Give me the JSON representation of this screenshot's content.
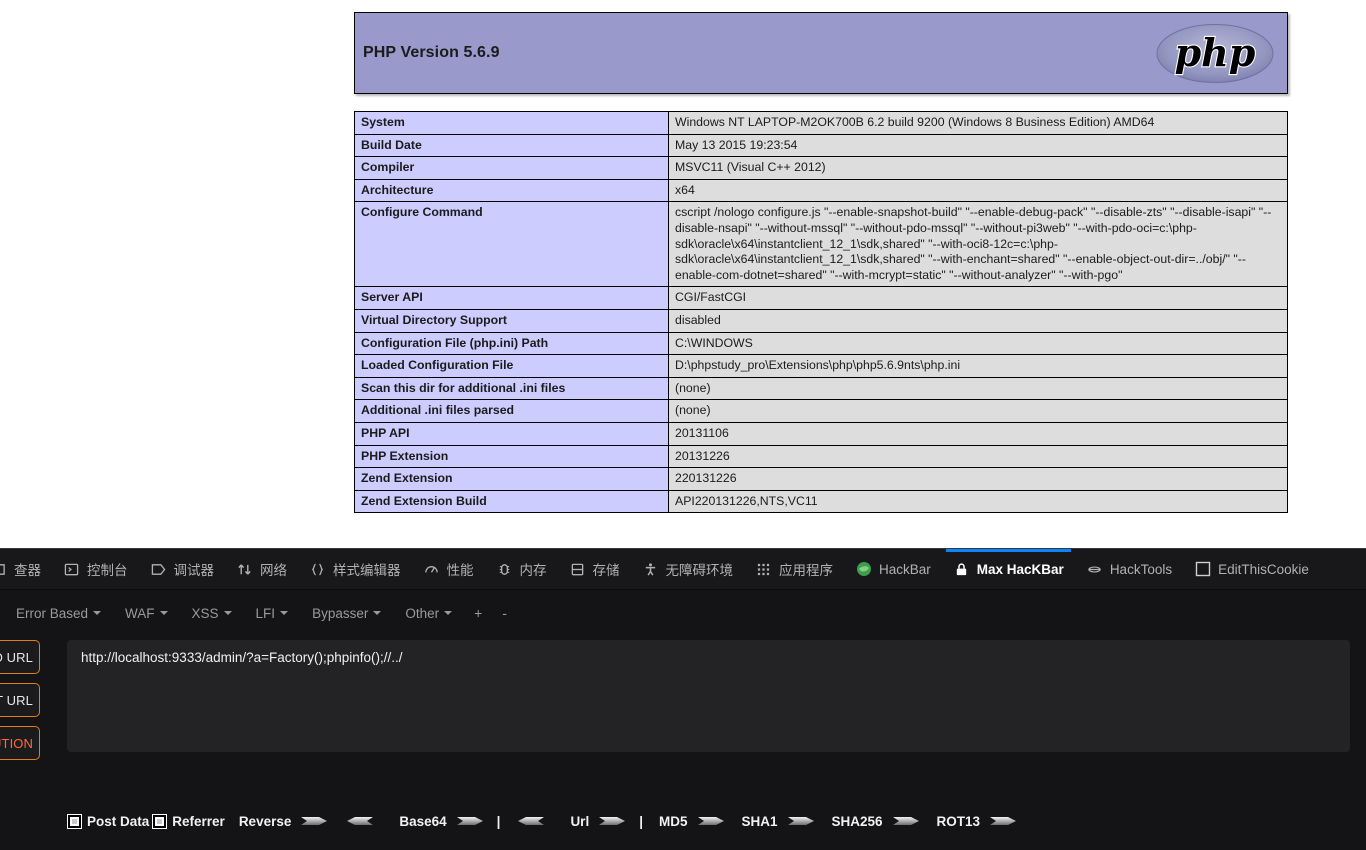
{
  "page": {
    "header_title": "PHP Version 5.6.9",
    "logo_text": "php",
    "rows": [
      {
        "key": "System",
        "value": "Windows NT LAPTOP-M2OK700B 6.2 build 9200 (Windows 8 Business Edition) AMD64"
      },
      {
        "key": "Build Date",
        "value": "May 13 2015 19:23:54"
      },
      {
        "key": "Compiler",
        "value": "MSVC11 (Visual C++ 2012)"
      },
      {
        "key": "Architecture",
        "value": "x64"
      },
      {
        "key": "Configure Command",
        "value": "cscript /nologo configure.js \"--enable-snapshot-build\" \"--enable-debug-pack\" \"--disable-zts\" \"--disable-isapi\" \"--disable-nsapi\" \"--without-mssql\" \"--without-pdo-mssql\" \"--without-pi3web\" \"--with-pdo-oci=c:\\php-sdk\\oracle\\x64\\instantclient_12_1\\sdk,shared\" \"--with-oci8-12c=c:\\php-sdk\\oracle\\x64\\instantclient_12_1\\sdk,shared\" \"--with-enchant=shared\" \"--enable-object-out-dir=../obj/\" \"--enable-com-dotnet=shared\" \"--with-mcrypt=static\" \"--without-analyzer\" \"--with-pgo\""
      },
      {
        "key": "Server API",
        "value": "CGI/FastCGI"
      },
      {
        "key": "Virtual Directory Support",
        "value": "disabled"
      },
      {
        "key": "Configuration File (php.ini) Path",
        "value": "C:\\WINDOWS"
      },
      {
        "key": "Loaded Configuration File",
        "value": "D:\\phpstudy_pro\\Extensions\\php\\php5.6.9nts\\php.ini"
      },
      {
        "key": "Scan this dir for additional .ini files",
        "value": "(none)"
      },
      {
        "key": "Additional .ini files parsed",
        "value": "(none)"
      },
      {
        "key": "PHP API",
        "value": "20131106"
      },
      {
        "key": "PHP Extension",
        "value": "20131226"
      },
      {
        "key": "Zend Extension",
        "value": "220131226"
      },
      {
        "key": "Zend Extension Build",
        "value": "API220131226,NTS,VC11"
      }
    ]
  },
  "devtools": {
    "tabs": [
      {
        "label": "查器",
        "icon": "inspector-icon",
        "active": false
      },
      {
        "label": "控制台",
        "icon": "console-icon",
        "active": false
      },
      {
        "label": "调试器",
        "icon": "debugger-icon",
        "active": false
      },
      {
        "label": "网络",
        "icon": "network-icon",
        "active": false
      },
      {
        "label": "样式编辑器",
        "icon": "style-editor-icon",
        "active": false
      },
      {
        "label": "性能",
        "icon": "performance-icon",
        "active": false
      },
      {
        "label": "内存",
        "icon": "memory-icon",
        "active": false
      },
      {
        "label": "存储",
        "icon": "storage-icon",
        "active": false
      },
      {
        "label": "无障碍环境",
        "icon": "accessibility-icon",
        "active": false
      },
      {
        "label": "应用程序",
        "icon": "application-icon",
        "active": false
      },
      {
        "label": "HackBar",
        "icon": "hackbar-icon",
        "active": false
      },
      {
        "label": "Max HacKBar",
        "icon": "lock-icon",
        "active": true
      },
      {
        "label": "HackTools",
        "icon": "hacktools-icon",
        "active": false
      },
      {
        "label": "EditThisCookie",
        "icon": "cookie-icon",
        "active": false
      }
    ]
  },
  "hackbar": {
    "menus": [
      {
        "label": "Error Based"
      },
      {
        "label": "WAF"
      },
      {
        "label": "XSS"
      },
      {
        "label": "LFI"
      },
      {
        "label": "Bypasser"
      },
      {
        "label": "Other"
      }
    ],
    "add_label": "+",
    "remove_label": "-",
    "side_buttons": [
      {
        "label": "LOAD URL",
        "style": "normal"
      },
      {
        "label": "SPLIT URL",
        "style": "normal"
      },
      {
        "label": "EXECUTION",
        "style": "exec"
      }
    ],
    "url_value": "http://localhost:9333/admin/?a=Factory();phpinfo();//../",
    "url_placeholder": "",
    "checkboxes": [
      {
        "label": "Post Data",
        "checked": false
      },
      {
        "label": "Referrer",
        "checked": false
      }
    ],
    "actions": [
      {
        "label": "Reverse",
        "right": true,
        "left": false
      },
      {
        "label": "",
        "right": false,
        "left": true
      },
      {
        "label": "Base64",
        "right": true,
        "left": false
      },
      {
        "label": "|",
        "separator": true
      },
      {
        "label": "",
        "right": false,
        "left": true
      },
      {
        "label": "Url",
        "right": true,
        "left": false
      },
      {
        "label": "|",
        "separator": true
      },
      {
        "label": "MD5",
        "right": true,
        "left": false
      },
      {
        "label": "SHA1",
        "right": true,
        "left": false
      },
      {
        "label": "SHA256",
        "right": true,
        "left": false
      },
      {
        "label": "ROT13",
        "right": true,
        "left": false
      }
    ]
  },
  "colors": {
    "php_header_bg": "#9999cc",
    "php_key_bg": "#ccccff",
    "php_val_bg": "#dddddd",
    "devtools_bg": "#0c0c0d",
    "accent_blue": "#0a84ff",
    "accent_orange": "#e08010",
    "exec_orange": "#ff6a3d"
  }
}
